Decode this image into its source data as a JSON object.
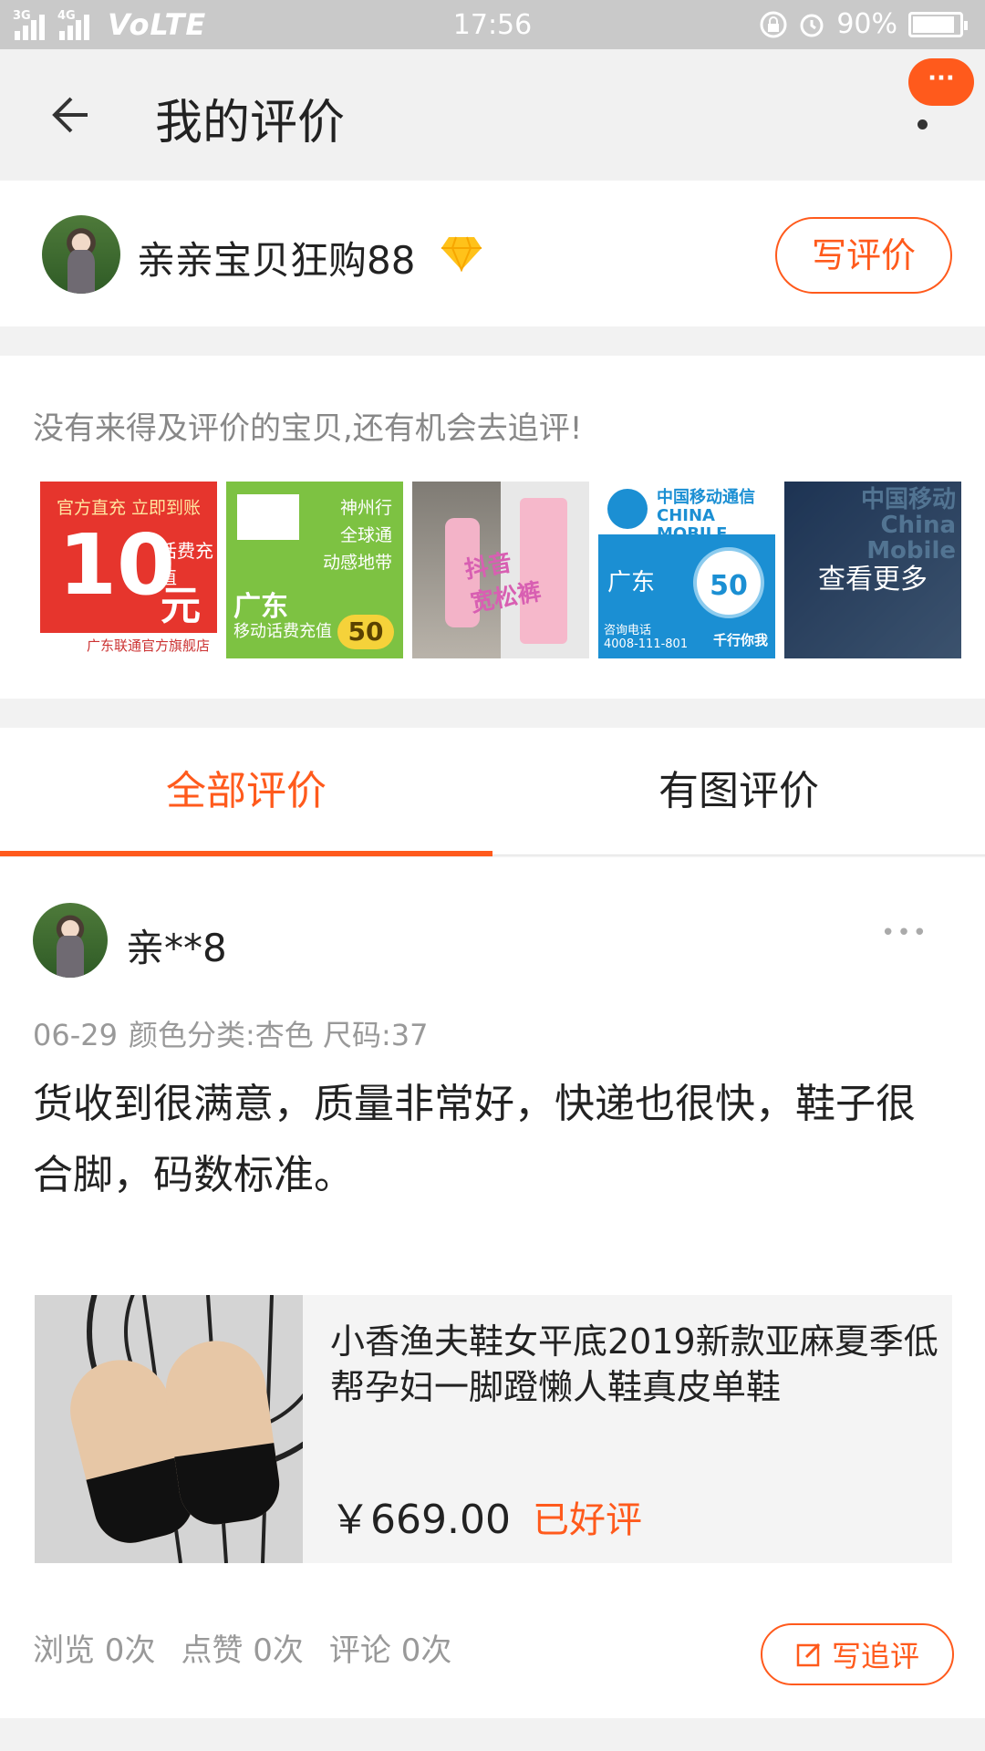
{
  "status_bar": {
    "network_1": "3G",
    "network_2": "4G",
    "volte": "VoLTE",
    "time": "17:56",
    "battery": "90%",
    "battery_level": 0.9
  },
  "header": {
    "title": "我的评价",
    "more_badge": "···"
  },
  "user": {
    "name": "亲亲宝贝狂购88",
    "write_review_label": "写评价"
  },
  "pending": {
    "hint": "没有来得及评价的宝贝,还有机会去追评!",
    "see_more": "查看更多",
    "thumb1": {
      "top": "官方直充 立即到账",
      "big": "10",
      "small": "话费充值",
      "unit": "元",
      "store": "广东联通官方旗舰店"
    },
    "thumb2": {
      "side": "神州行\n全球通\n动感地带",
      "region": "广东",
      "footer": "移动话费充值",
      "amount": "50"
    },
    "thumb3": {
      "watermark": "抖音\n宽松裤"
    },
    "thumb4": {
      "brand": "中国移动通信\nCHINA MOBILE",
      "region": "广东",
      "amount": "50",
      "hotline": "咨询电话\n4008-111-801",
      "slogan": "千行你我"
    },
    "thumb5": {
      "brand": "中国移动\nChina Mobile"
    }
  },
  "tabs": [
    {
      "label": "全部评价"
    },
    {
      "label": "有图评价"
    }
  ],
  "review": {
    "user": "亲**8",
    "more": "•••",
    "date": "06-29",
    "sku": "颜色分类:杏色 尺码:37",
    "content": "货收到很满意，质量非常好，快递也很快，鞋子很合脚，码数标准。",
    "product_title": "小香渔夫鞋女平底2019新款亚麻夏季低帮孕妇一脚蹬懒人鞋真皮单鞋",
    "price": "￥669.00",
    "rating_status": "已好评",
    "views": "浏览 0次",
    "likes": "点赞 0次",
    "comments": "评论 0次",
    "follow_up_label": "写追评"
  },
  "colors": {
    "accent": "#ff5a1c"
  }
}
